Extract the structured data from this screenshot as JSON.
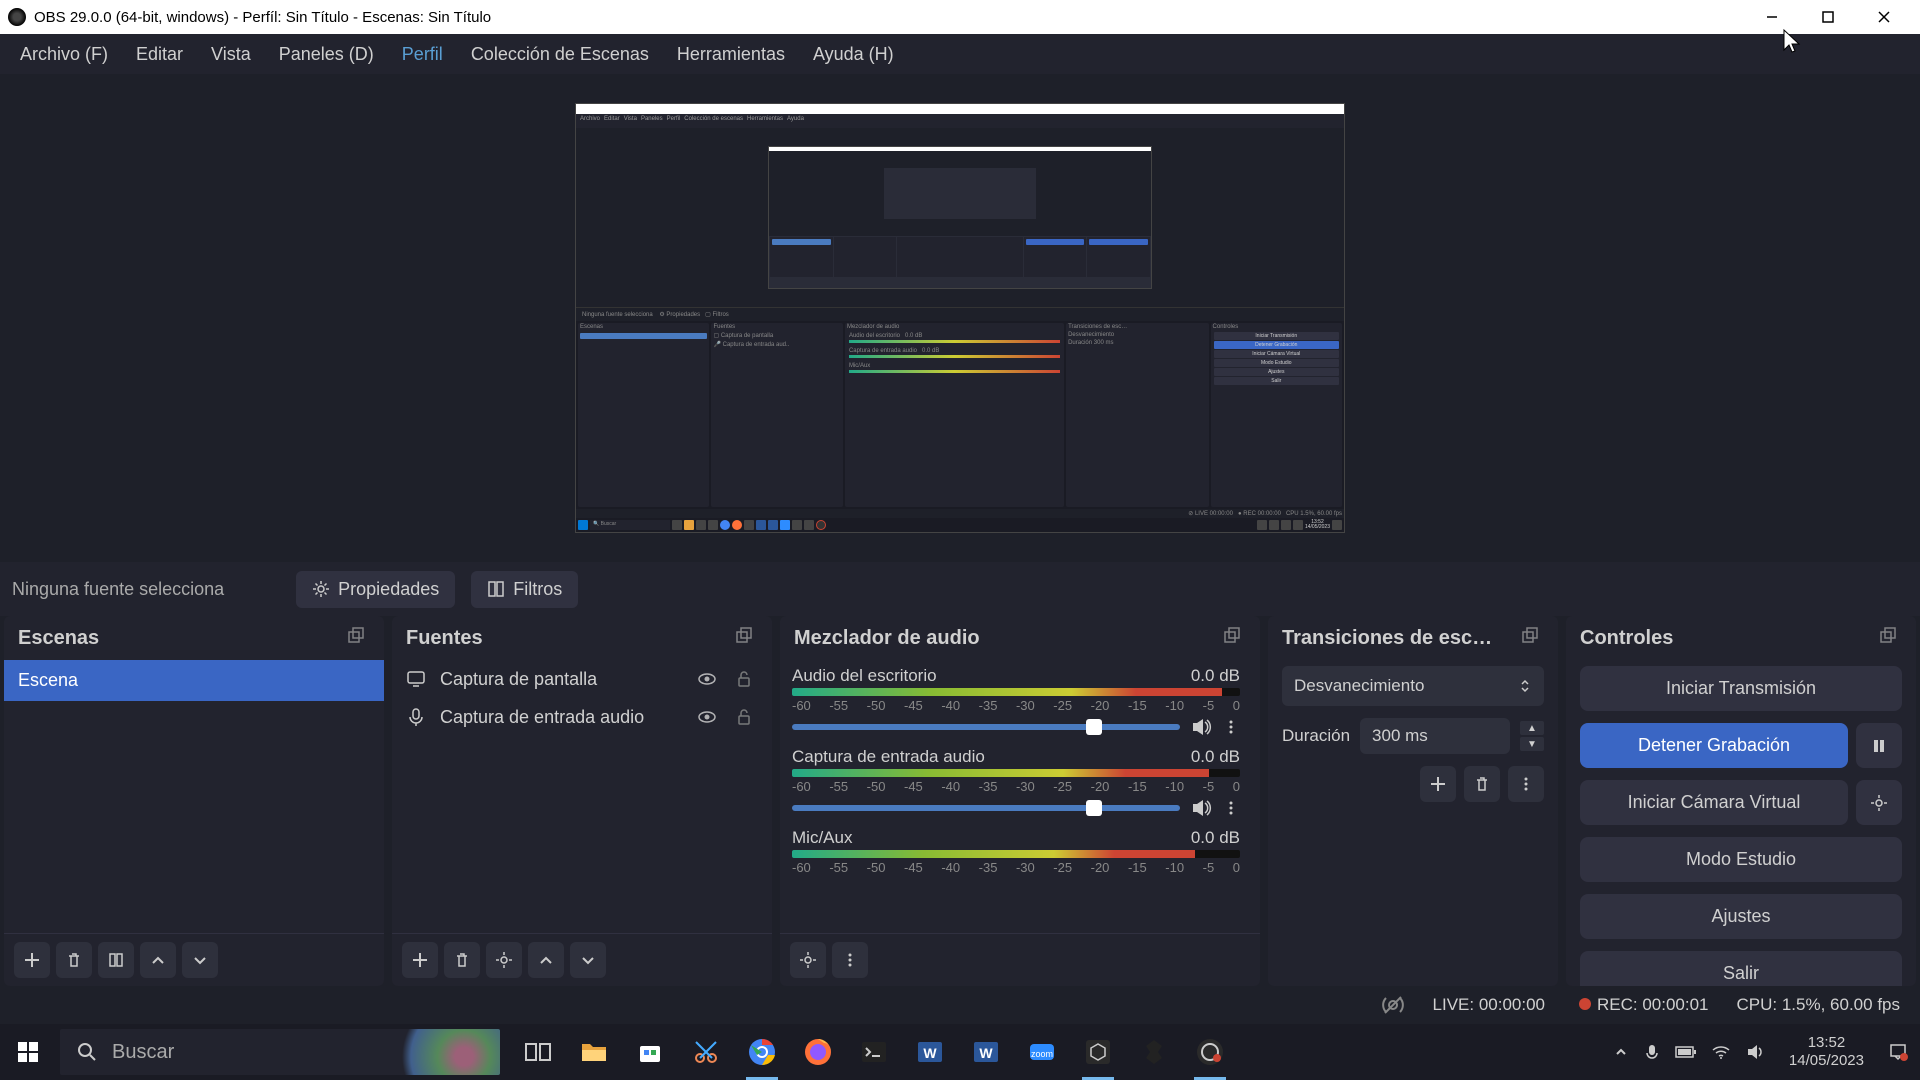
{
  "window": {
    "title": "OBS 29.0.0 (64-bit, windows) - Perfíl: Sin Título - Escenas: Sin Título"
  },
  "menu": {
    "archivo": "Archivo (F)",
    "editar": "Editar",
    "vista": "Vista",
    "paneles": "Paneles (D)",
    "perfil": "Perfil",
    "coleccion": "Colección de Escenas",
    "herramientas": "Herramientas",
    "ayuda": "Ayuda (H)"
  },
  "secondary": {
    "no_source": "Ninguna fuente selecciona",
    "properties": "Propiedades",
    "filters": "Filtros"
  },
  "panels": {
    "scenes": {
      "title": "Escenas",
      "items": [
        "Escena"
      ]
    },
    "sources": {
      "title": "Fuentes",
      "items": [
        {
          "name": "Captura de pantalla",
          "icon": "display"
        },
        {
          "name": "Captura de entrada audio",
          "icon": "mic"
        }
      ]
    },
    "mixer": {
      "title": "Mezclador de audio",
      "tracks": [
        {
          "name": "Audio del escritorio",
          "db": "0.0 dB",
          "level": 96
        },
        {
          "name": "Captura de entrada audio",
          "db": "0.0 dB",
          "level": 93
        },
        {
          "name": "Mic/Aux",
          "db": "0.0 dB",
          "level": 90
        }
      ],
      "scale": [
        "-60",
        "-55",
        "-50",
        "-45",
        "-40",
        "-35",
        "-30",
        "-25",
        "-20",
        "-15",
        "-10",
        "-5",
        "0"
      ]
    },
    "transitions": {
      "title": "Transiciones de esc…",
      "selected": "Desvanecimiento",
      "duration_label": "Duración",
      "duration_value": "300 ms"
    },
    "controls": {
      "title": "Controles",
      "start_stream": "Iniciar Transmisión",
      "stop_record": "Detener Grabación",
      "virtual_cam": "Iniciar Cámara Virtual",
      "studio": "Modo Estudio",
      "settings": "Ajustes",
      "exit": "Salir"
    }
  },
  "status": {
    "live": "LIVE: 00:00:00",
    "rec": "REC: 00:00:01",
    "cpu": "CPU: 1.5%, 60.00 fps"
  },
  "taskbar": {
    "search_placeholder": "Buscar",
    "time": "13:52",
    "date": "14/05/2023"
  }
}
